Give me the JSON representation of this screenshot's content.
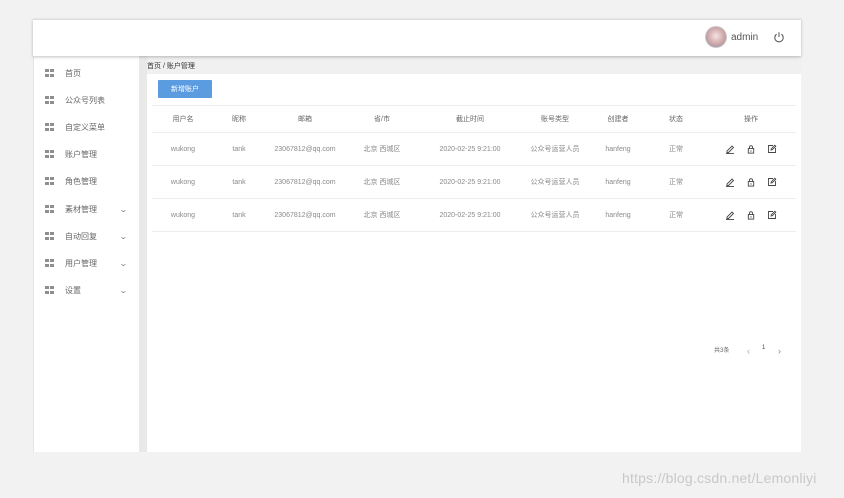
{
  "header": {
    "username": "admin",
    "power_icon": "power-icon"
  },
  "sidebar": {
    "items": [
      {
        "label": "首页",
        "icon": "grid-icon",
        "expandable": false
      },
      {
        "label": "公众号列表",
        "icon": "grid-icon",
        "expandable": false
      },
      {
        "label": "自定义菜单",
        "icon": "grid-icon",
        "expandable": false
      },
      {
        "label": "账户管理",
        "icon": "grid-icon",
        "expandable": false
      },
      {
        "label": "角色管理",
        "icon": "grid-icon",
        "expandable": false
      },
      {
        "label": "素材管理",
        "icon": "grid-icon",
        "expandable": true
      },
      {
        "label": "自动回复",
        "icon": "grid-icon",
        "expandable": true
      },
      {
        "label": "用户管理",
        "icon": "grid-icon",
        "expandable": true
      },
      {
        "label": "设置",
        "icon": "grid-icon",
        "expandable": true
      }
    ],
    "chevron": "⌄"
  },
  "breadcrumb": "首页 / 账户管理",
  "toolbar": {
    "add_label": "新增账户"
  },
  "table": {
    "columns": [
      "用户名",
      "昵称",
      "邮箱",
      "省/市",
      "截止时间",
      "账号类型",
      "创建者",
      "状态",
      "操作"
    ],
    "rows": [
      [
        "wukong",
        "tank",
        "23067812@qq.com",
        "北京 西城区",
        "2020-02-25 9:21:00",
        "公众号运营人员",
        "hanfeng",
        "正常"
      ],
      [
        "wukong",
        "tank",
        "23067812@qq.com",
        "北京 西城区",
        "2020-02-25 9:21:00",
        "公众号运营人员",
        "hanfeng",
        "正常"
      ],
      [
        "wukong",
        "tank",
        "23067812@qq.com",
        "北京 西城区",
        "2020-02-25 9:21:00",
        "公众号运营人员",
        "hanfeng",
        "正常"
      ]
    ],
    "op_icons": [
      "edit-icon",
      "lock-icon",
      "edit-box-icon"
    ]
  },
  "pagination": {
    "total": "共3条",
    "prev": "‹",
    "page": "1",
    "next": "›"
  },
  "watermark": "https://blog.csdn.net/Lemonliyi"
}
